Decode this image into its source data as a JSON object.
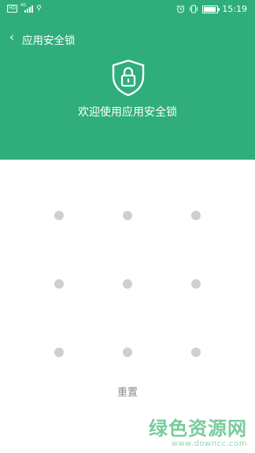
{
  "status_bar": {
    "hd_badge": "HD",
    "network": "4G",
    "usb_icon": "usb-icon",
    "icons": [
      "alarm-icon",
      "vibrate-icon",
      "battery-icon"
    ],
    "battery_fill": 0.9,
    "time": "15:19"
  },
  "nav": {
    "back_icon": "chevron-left-icon",
    "title": "应用安全锁"
  },
  "hero": {
    "icon": "shield-lock-icon",
    "welcome_text": "欢迎使用应用安全锁"
  },
  "pattern_lock": {
    "rows": 3,
    "cols": 3,
    "dot_color": "#cfcfcf"
  },
  "reset_label": "重置",
  "watermark": {
    "text": "绿色资源网",
    "url": "www.downcc.com"
  },
  "colors": {
    "header_bg": "#2fae7c",
    "body_bg": "#ffffff"
  }
}
